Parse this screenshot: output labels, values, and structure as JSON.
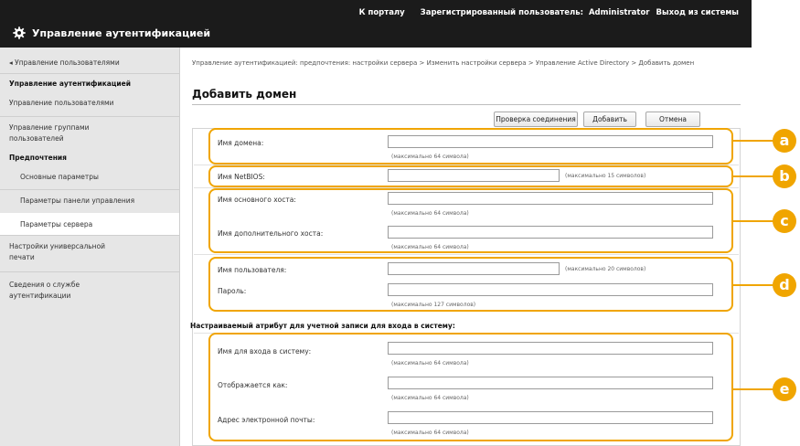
{
  "topnav": {
    "portal": "К порталу",
    "user_label": "Зарегистрированный пользователь:",
    "user_name": "Administrator",
    "logout": "Выход из системы"
  },
  "app": {
    "title": "Управление аутентификацией",
    "icon": "gear-icon"
  },
  "sidebar": {
    "back": "◂ Управление пользователями",
    "items": [
      {
        "label": "Управление аутентификацией",
        "style": "bold"
      },
      {
        "label": "Управление пользователями",
        "style": "normal"
      },
      {
        "label": "Управление группами пользователей",
        "style": "normal"
      },
      {
        "label": "Предпочтения",
        "style": "bold"
      },
      {
        "label": "Основные параметры",
        "style": "sub"
      },
      {
        "label": "Параметры панели управления",
        "style": "sub"
      },
      {
        "label": "Параметры сервера",
        "style": "sub",
        "active": true
      },
      {
        "label": "Настройки универсальной печати",
        "style": "normal"
      },
      {
        "label": "Сведения о службе аутентификации",
        "style": "normal"
      }
    ]
  },
  "main": {
    "breadcrumb": "Управление аутентификацией: предпочтения: настройки сервера > Изменить настройки сервера > Управление Active Directory > Добавить домен",
    "title": "Добавить домен",
    "buttons": {
      "check": "Проверка соединения",
      "add": "Добавить",
      "cancel": "Отмена"
    }
  },
  "form": {
    "domain_name": {
      "label": "Имя домена:",
      "value": "",
      "hint": "(максимально 64 символа)"
    },
    "netbios": {
      "label": "Имя NetBIOS:",
      "value": "",
      "hint": "(максимально 15 символов)"
    },
    "primary_host": {
      "label": "Имя основного хоста:",
      "value": "",
      "hint": "(максимально 64 символа)"
    },
    "secondary_host": {
      "label": "Имя дополнительного хоста:",
      "value": "",
      "hint": "(максимально 64 символа)"
    },
    "username": {
      "label": "Имя пользователя:",
      "value": "",
      "hint": "(максимально 20 символов)"
    },
    "password": {
      "label": "Пароль:",
      "value": "",
      "hint": "(максимально 127 символов)"
    },
    "attributes_heading": "Настраиваемый атрибут для учетной записи для входа в систему:",
    "login_name": {
      "label": "Имя для входа в систему:",
      "value": "",
      "hint": "(максимально 64 символа)"
    },
    "display_as": {
      "label": "Отображается как:",
      "value": "",
      "hint": "(максимально 64 символа)"
    },
    "email": {
      "label": "Адрес электронной почты:",
      "value": "",
      "hint": "(максимально 64 символа)"
    }
  },
  "callouts": [
    "a",
    "b",
    "c",
    "d",
    "e"
  ],
  "colors": {
    "topbar": "#1b1b1b",
    "sidebar": "#e6e6e6",
    "callout": "#f0a500"
  }
}
